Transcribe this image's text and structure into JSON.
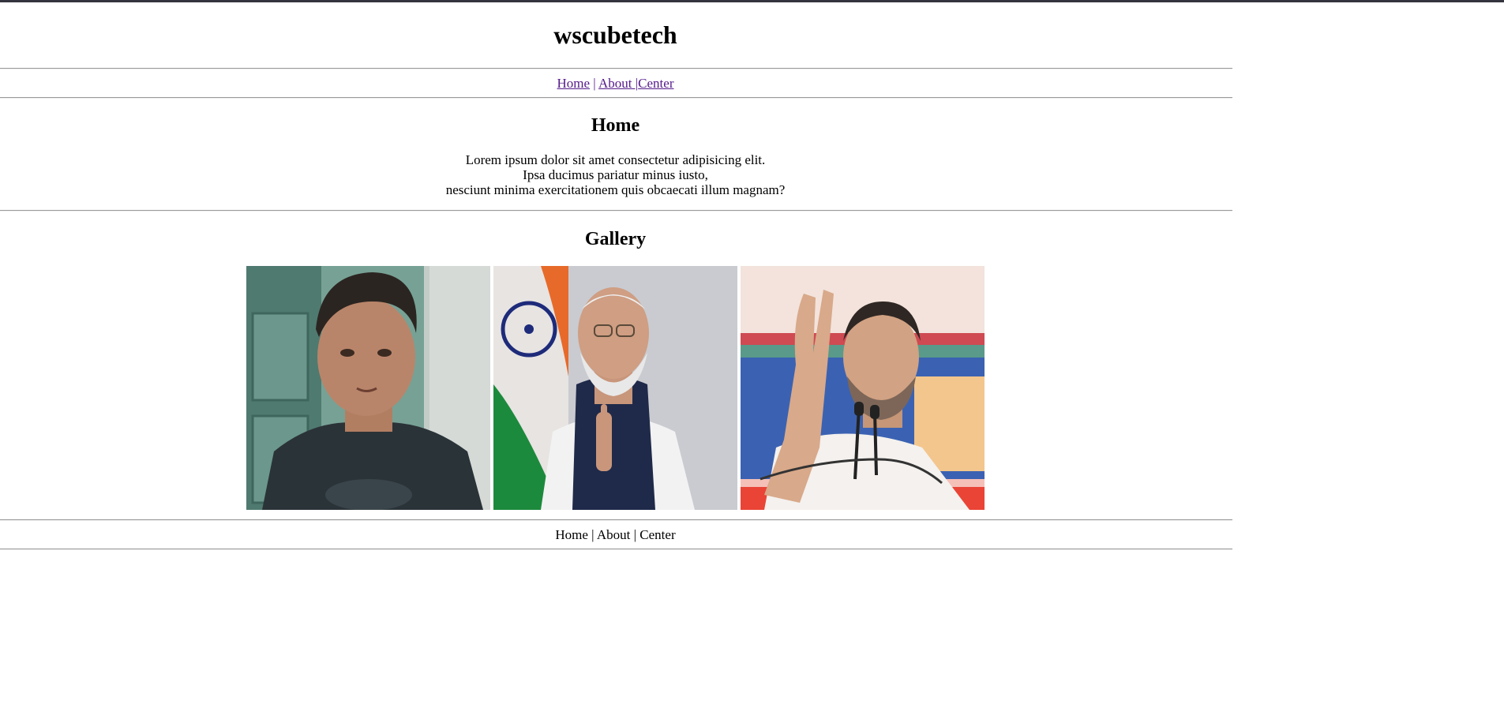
{
  "header": {
    "title": "wscubetech"
  },
  "nav": {
    "home": "Home",
    "sep1": " | ",
    "about": " About |",
    "center": "Center"
  },
  "home": {
    "title": "Home",
    "lines": [
      "Lorem ipsum dolor sit amet consectetur adipisicing elit.",
      "Ipsa ducimus pariatur minus iusto,",
      "nesciunt minima exercitationem quis obcaecati illum magnam?"
    ]
  },
  "gallery": {
    "title": "Gallery",
    "images": [
      {
        "name": "portrait-man-dark-tshirt",
        "background": "#5d8a80"
      },
      {
        "name": "portrait-man-flag-background",
        "background": "#c9cbd0"
      },
      {
        "name": "portrait-man-waving-microphones",
        "background": "#f1c7b8"
      }
    ]
  },
  "footer_nav": {
    "home": "Home",
    "about": "About",
    "center": "Center",
    "separator": "|"
  },
  "colors": {
    "link_visited": "#551a8b",
    "top_bar": "#34343f",
    "rule": "#9a9a9a"
  }
}
